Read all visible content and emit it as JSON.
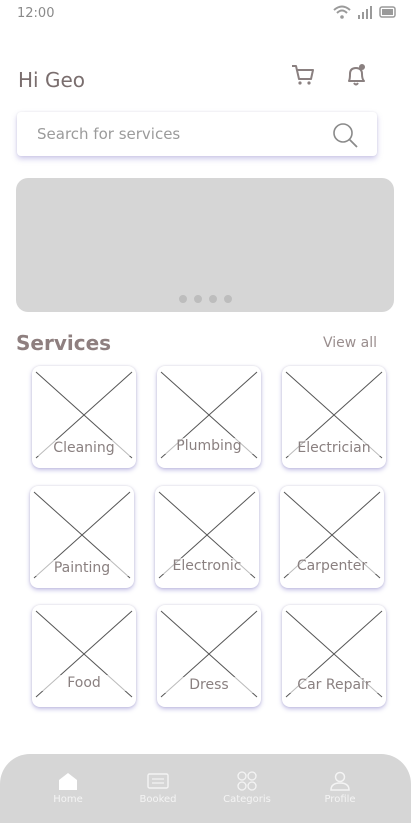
{
  "status": {
    "time": "12:00",
    "icons": [
      "wifi-icon",
      "signal-icon",
      "battery-icon"
    ]
  },
  "header": {
    "greeting": "Hi Geo",
    "icons": [
      "cart-icon",
      "bell-icon"
    ]
  },
  "search": {
    "placeholder": "Search for services",
    "icon": "search-icon"
  },
  "banner": {
    "dots": 4
  },
  "services": {
    "title": "Services",
    "view_all": "View all",
    "items": [
      {
        "label": "Cleaning"
      },
      {
        "label": "Plumbing"
      },
      {
        "label": "Electrician"
      },
      {
        "label": "Painting"
      },
      {
        "label": "Electronic"
      },
      {
        "label": "Carpenter"
      },
      {
        "label": "Food"
      },
      {
        "label": "Dress"
      },
      {
        "label": "Car Repair"
      }
    ]
  },
  "bottom_nav": {
    "items": [
      {
        "label": "Home",
        "icon": "home-icon"
      },
      {
        "label": "Booked",
        "icon": "booked-icon"
      },
      {
        "label": "Categoris",
        "icon": "categories-icon"
      },
      {
        "label": "Profile",
        "icon": "profile-icon"
      }
    ]
  },
  "colors": {
    "banner": "#d6d6d6",
    "nav_bg": "#d6d6d6",
    "card_shadow": "#7a6ec8",
    "text_primary": "#7a6e6e"
  }
}
